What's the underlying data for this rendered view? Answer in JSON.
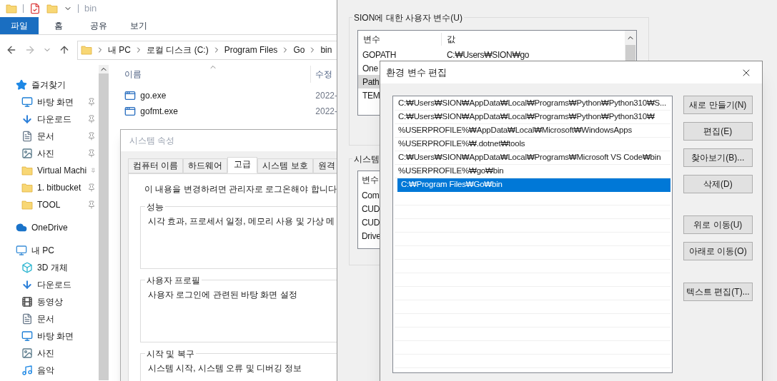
{
  "explorer": {
    "title": "bin",
    "ribbon_tabs": [
      {
        "label": "파일",
        "selected": true
      },
      {
        "label": "홈",
        "selected": false
      },
      {
        "label": "공유",
        "selected": false
      },
      {
        "label": "보기",
        "selected": false
      }
    ],
    "breadcrumb": [
      "내 PC",
      "로컬 디스크 (C:)",
      "Program Files",
      "Go",
      "bin"
    ],
    "columns": [
      "이름",
      "수정"
    ],
    "files": [
      {
        "name": "go.exe",
        "modified": "2022-"
      },
      {
        "name": "gofmt.exe",
        "modified": "2022-"
      }
    ],
    "nav_tree": [
      {
        "label": "즐겨찾기",
        "kind": "star",
        "children": [
          {
            "label": "바탕 화면",
            "kind": "desktop",
            "pinned": true
          },
          {
            "label": "다운로드",
            "kind": "download",
            "pinned": true
          },
          {
            "label": "문서",
            "kind": "document",
            "pinned": true
          },
          {
            "label": "사진",
            "kind": "picture",
            "pinned": true
          },
          {
            "label": "Virtual Machi",
            "kind": "folder",
            "pinned": true
          },
          {
            "label": "1. bitbucket",
            "kind": "folder",
            "pinned": true
          },
          {
            "label": "TOOL",
            "kind": "folder",
            "pinned": true
          }
        ]
      },
      {
        "label": "OneDrive",
        "kind": "cloud"
      },
      {
        "label": "내 PC",
        "kind": "pc",
        "children": [
          {
            "label": "3D 개체",
            "kind": "cube",
            "pinned": false
          },
          {
            "label": "다운로드",
            "kind": "download",
            "pinned": false
          },
          {
            "label": "동영상",
            "kind": "video",
            "pinned": false
          },
          {
            "label": "문서",
            "kind": "document",
            "pinned": false
          },
          {
            "label": "바탕 화면",
            "kind": "desktop",
            "pinned": false
          },
          {
            "label": "사진",
            "kind": "picture",
            "pinned": false
          },
          {
            "label": "음악",
            "kind": "music",
            "pinned": false
          }
        ]
      }
    ]
  },
  "system_properties": {
    "title": "시스템 속성",
    "tabs": [
      {
        "label": "컴퓨터 이름",
        "selected": false
      },
      {
        "label": "하드웨어",
        "selected": false
      },
      {
        "label": "고급",
        "selected": true
      },
      {
        "label": "시스템 보호",
        "selected": false
      },
      {
        "label": "원격",
        "selected": false
      }
    ],
    "notice": "이 내용을 변경하려면 관리자로 로그온해야 합니다",
    "groups": [
      {
        "title": "성능",
        "description": "시각 효과, 프로세서 일정, 메모리 사용 및 가상 메"
      },
      {
        "title": "사용자 프로필",
        "description": "사용자 로그인에 관련된 바탕 화면 설정"
      },
      {
        "title": "시작 및 복구",
        "description": "시스템 시작, 시스템 오류 및 디버깅 정보"
      }
    ]
  },
  "environment_variables": {
    "user_group": "SION에 대한 사용자 변수(U)",
    "user_columns": [
      "변수",
      "값"
    ],
    "user_rows": [
      {
        "name": "GOPATH",
        "value": "C:₩Users₩SION₩go",
        "selected": false
      },
      {
        "name": "One",
        "selected": false
      },
      {
        "name": "Path",
        "selected": true
      },
      {
        "name": "TEM",
        "selected": false
      }
    ],
    "system_group": "시스템",
    "system_column": "변수",
    "system_rows": [
      "Com",
      "CUD",
      "CUD",
      "Drive"
    ]
  },
  "edit_dialog": {
    "title": "환경 변수 편집",
    "paths": [
      {
        "text": "C:₩Users₩SION₩AppData₩Local₩Programs₩Python₩Python310₩S...",
        "selected": false
      },
      {
        "text": "C:₩Users₩SION₩AppData₩Local₩Programs₩Python₩Python310₩",
        "selected": false
      },
      {
        "text": "%USERPROFILE%₩AppData₩Local₩Microsoft₩WindowsApps",
        "selected": false
      },
      {
        "text": "%USERPROFILE%₩.dotnet₩tools",
        "selected": false
      },
      {
        "text": "C:₩Users₩SION₩AppData₩Local₩Programs₩Microsoft VS Code₩bin",
        "selected": false
      },
      {
        "text": "%USERPROFILE%₩go₩bin",
        "selected": false
      },
      {
        "text": "C:₩Program Files₩Go₩bin",
        "selected": true
      }
    ],
    "buttons": [
      "새로 만들기(N)",
      "편집(E)",
      "찾아보기(B)...",
      "삭제(D)",
      "위로 이동(U)",
      "아래로 이동(O)",
      "텍스트 편집(T)..."
    ]
  }
}
